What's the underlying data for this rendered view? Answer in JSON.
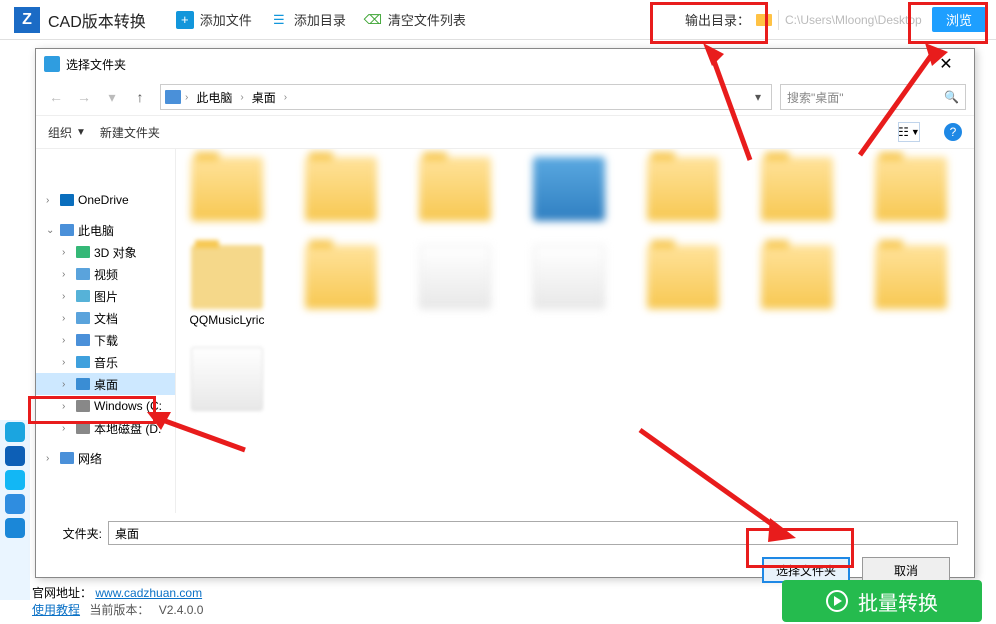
{
  "app": {
    "title": "CAD版本转换"
  },
  "toolbar": {
    "add_file": "添加文件",
    "add_dir": "添加目录",
    "clear_list": "清空文件列表",
    "out_label": "输出目录：",
    "out_path": "C:\\Users\\Mloong\\Desktop",
    "browse": "浏览"
  },
  "dialog": {
    "title": "选择文件夹",
    "breadcrumb": {
      "seg1": "此电脑",
      "seg2": "桌面"
    },
    "search_placeholder": "搜索\"桌面\"",
    "tb": {
      "organize": "组织",
      "new_folder": "新建文件夹"
    },
    "tree": {
      "onedrive": "OneDrive",
      "this_pc": "此电脑",
      "obj3d": "3D 对象",
      "video": "视频",
      "pictures": "图片",
      "documents": "文档",
      "downloads": "下载",
      "music": "音乐",
      "desktop": "桌面",
      "windows_c": "Windows (C:",
      "local_d": "本地磁盘 (D:",
      "network": "网络"
    },
    "files": {
      "qqmusic": "QQMusicLyric"
    },
    "folder_label": "文件夹:",
    "folder_value": "桌面",
    "ok": "选择文件夹",
    "cancel": "取消"
  },
  "footer": {
    "site_label": "官网地址：",
    "site_url": "www.cadzhuan.com",
    "tutorial": "使用教程",
    "ver_label": "当前版本：",
    "version": "V2.4.0.0",
    "batch": "批量转换"
  }
}
